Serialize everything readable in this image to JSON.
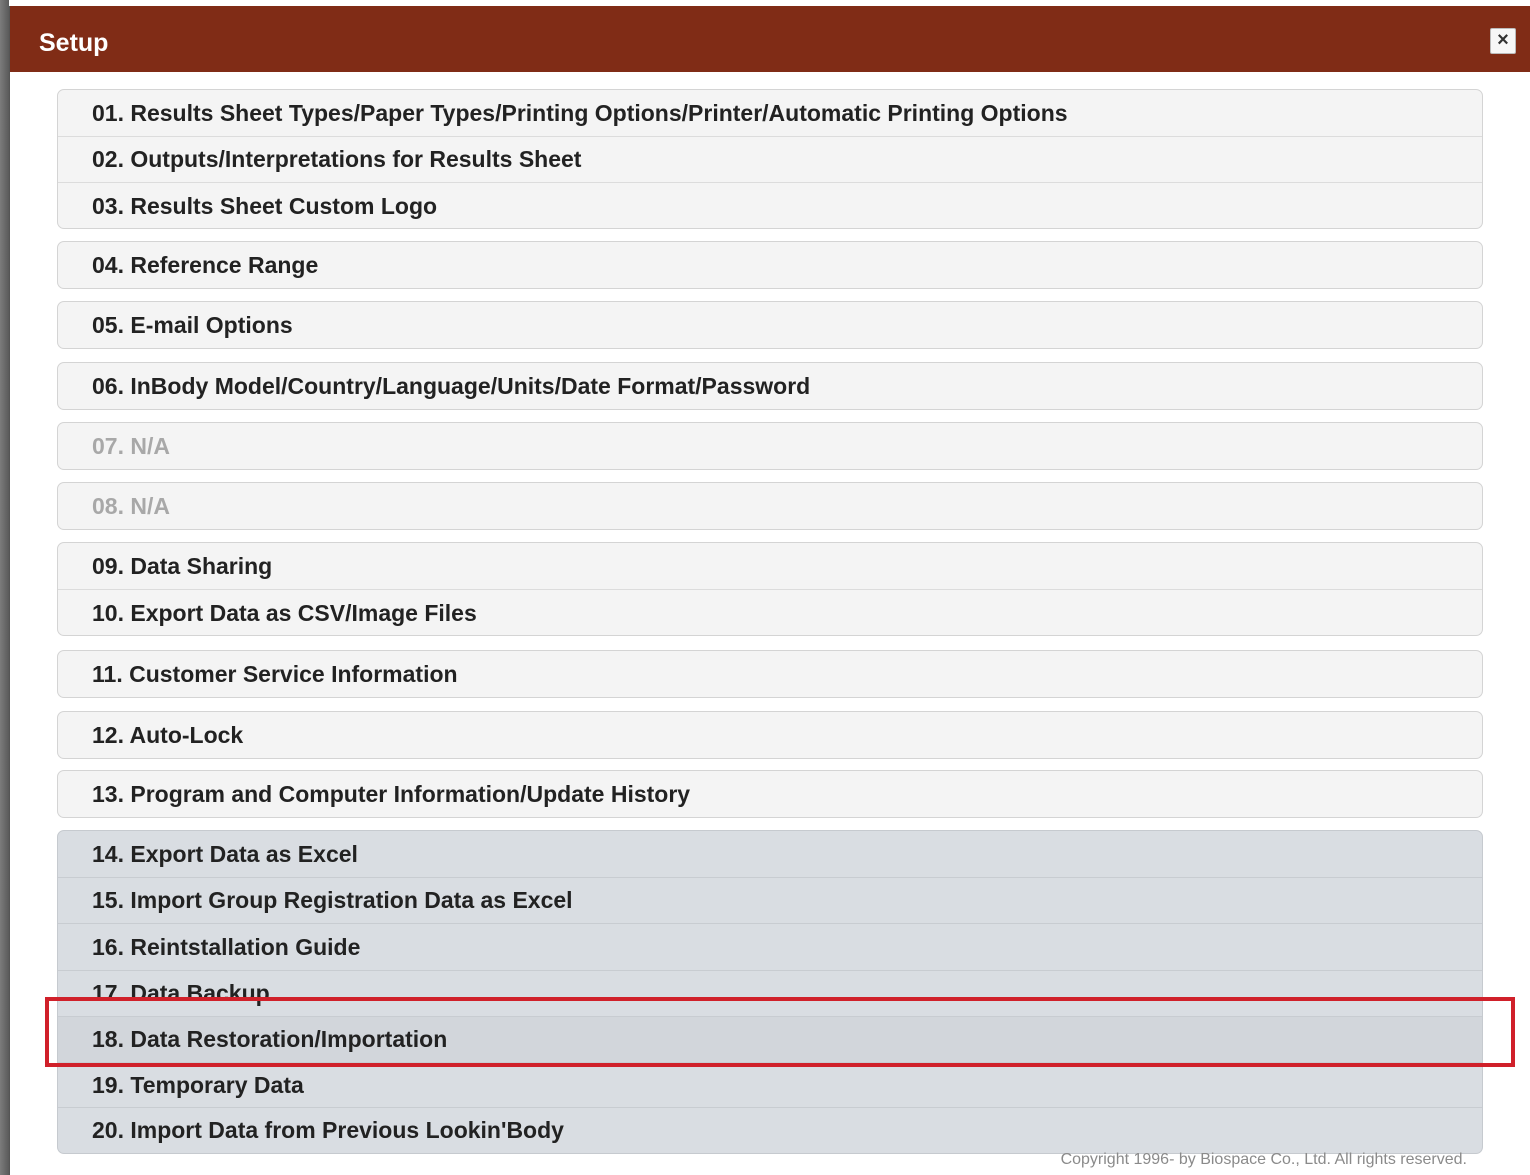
{
  "dialog": {
    "title": "Setup",
    "close_glyph": "×"
  },
  "menu": {
    "items": [
      {
        "label": "01. Results Sheet Types/Paper Types/Printing Options/Printer/Automatic Printing Options",
        "enabled": true
      },
      {
        "label": "02. Outputs/Interpretations for Results Sheet",
        "enabled": true
      },
      {
        "label": "03. Results Sheet Custom Logo",
        "enabled": true
      },
      {
        "label": "04. Reference Range",
        "enabled": true
      },
      {
        "label": "05. E-mail Options",
        "enabled": true
      },
      {
        "label": "06. InBody Model/Country/Language/Units/Date Format/Password",
        "enabled": true
      },
      {
        "label": "07. N/A",
        "enabled": false
      },
      {
        "label": "08. N/A",
        "enabled": false
      },
      {
        "label": "09. Data Sharing",
        "enabled": true
      },
      {
        "label": "10. Export Data as CSV/Image Files",
        "enabled": true
      },
      {
        "label": "11. Customer Service Information",
        "enabled": true
      },
      {
        "label": "12. Auto-Lock",
        "enabled": true
      },
      {
        "label": "13. Program and Computer Information/Update History",
        "enabled": true
      },
      {
        "label": "14. Export Data as Excel",
        "enabled": true
      },
      {
        "label": "15. Import Group Registration Data as Excel",
        "enabled": true
      },
      {
        "label": "16. Reintstallation Guide",
        "enabled": true
      },
      {
        "label": "17. Data Backup",
        "enabled": true
      },
      {
        "label": "18. Data Restoration/Importation",
        "enabled": true,
        "highlighted": true
      },
      {
        "label": "19. Temporary Data",
        "enabled": true
      },
      {
        "label": "20. Import Data from Previous Lookin'Body",
        "enabled": true
      }
    ]
  },
  "footer": {
    "copyright": "Copyright 1996- by Biospace Co., Ltd. All rights reserved."
  },
  "colors": {
    "titlebar": "#802c16",
    "highlight": "#d0202a"
  }
}
